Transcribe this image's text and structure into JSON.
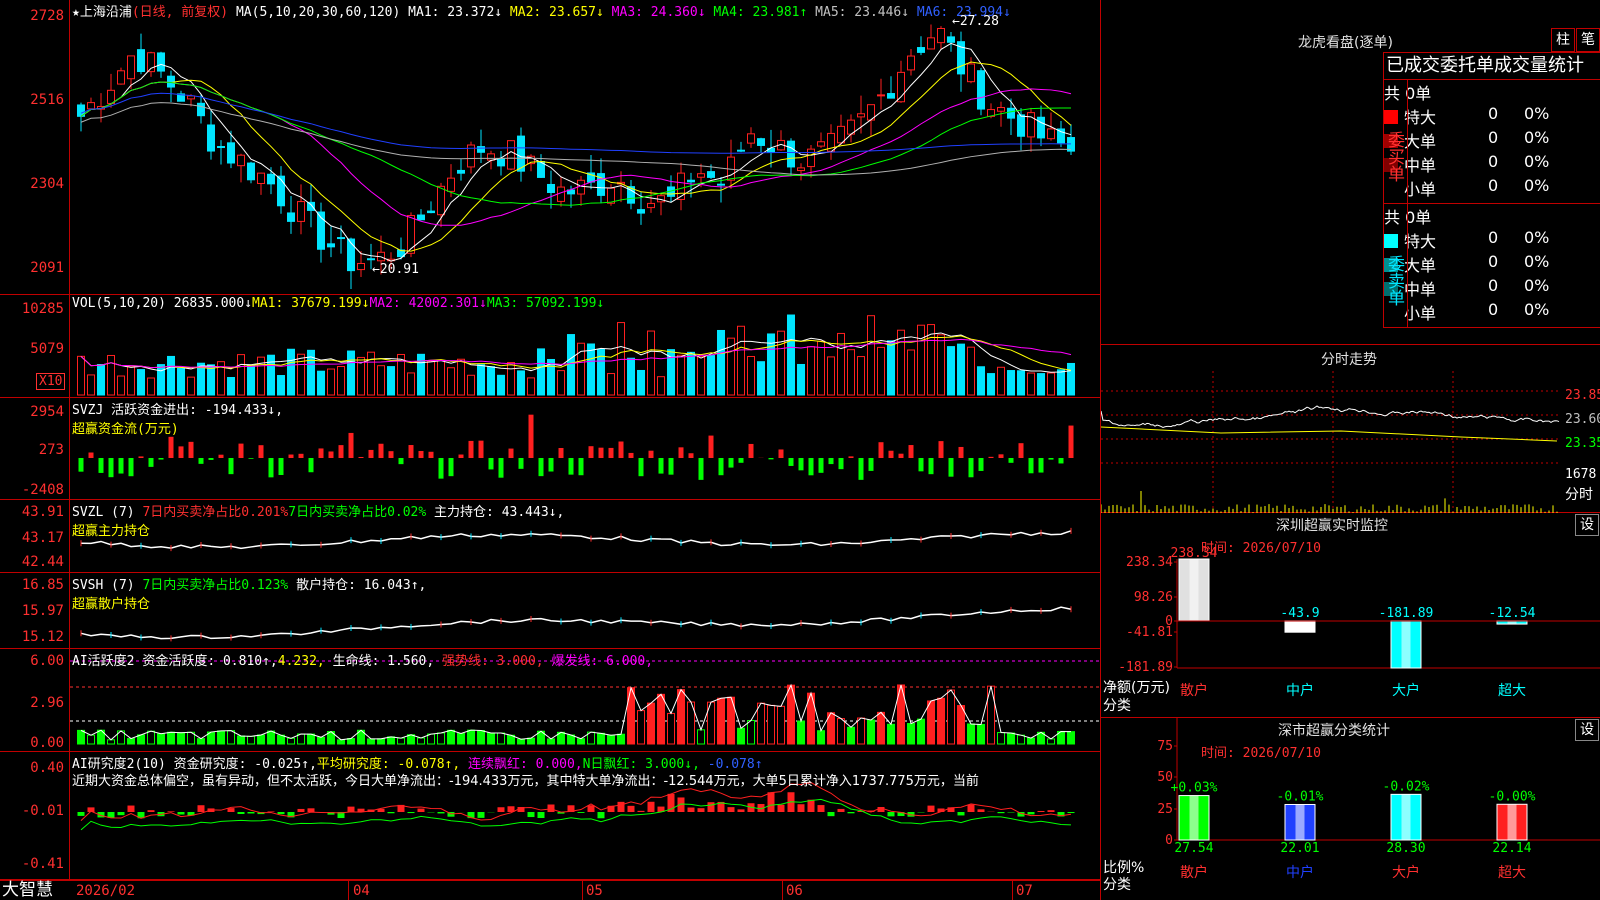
{
  "main": {
    "stock_name": "★上海沿浦",
    "period": "(日线, 前复权)",
    "ma_params": "MA(5,10,20,30,60,120)",
    "ma": [
      {
        "label": "MA1:",
        "value": "23.372↓",
        "color": "#ffffff"
      },
      {
        "label": "MA2:",
        "value": "23.657↓",
        "color": "#ffff00"
      },
      {
        "label": "MA3:",
        "value": "24.360↓",
        "color": "#ff00ff"
      },
      {
        "label": "MA4:",
        "value": "23.981↑",
        "color": "#00ff00"
      },
      {
        "label": "MA5:",
        "value": "23.446↓",
        "color": "#c0c0c0"
      },
      {
        "label": "MA6:",
        "value": "23.994↓",
        "color": "#3060ff"
      }
    ],
    "y_labels": [
      "2728",
      "2516",
      "2304",
      "2091"
    ],
    "high_label": "27.28",
    "low_label": "20.91",
    "colors": {
      "up": "#ff2020",
      "down": "#00e5ff",
      "ma1": "#ffffff",
      "ma2": "#ffff00",
      "ma3": "#ff00ff",
      "ma4": "#00ff00",
      "ma5": "#b0b0b0",
      "ma6": "#2040ff"
    }
  },
  "vol": {
    "params": "VOL(5,10,20)",
    "value": "26835.000↓",
    "ma1": "MA1: 37679.199↓",
    "ma2": "MA2: 42002.301↓",
    "ma3": "MA3: 57092.199↓",
    "y_labels": [
      "10285",
      "5079"
    ],
    "unit": "X10"
  },
  "svzj": {
    "name": "SVZJ",
    "label": "活跃资金进出: -194.433↓,",
    "subtitle": "超赢资金流(万元)",
    "y_labels": [
      "2954",
      "273",
      "-2408"
    ]
  },
  "svzl": {
    "name": "SVZL (7)",
    "l1": "7日内买卖净占比0.201%",
    "l2": "7日内买卖净占比0.02%",
    "l3": "主力持仓: 43.443↓,",
    "subtitle": "超赢主力持仓",
    "y_labels": [
      "43.91",
      "43.17",
      "42.44"
    ]
  },
  "svsh": {
    "name": "SVSH (7)",
    "l1": "7日内买卖净占比0.123%",
    "l2": "散户持仓: 16.043↑,",
    "subtitle": "超赢散户持仓",
    "y_labels": [
      "16.85",
      "15.97",
      "15.12"
    ]
  },
  "ai1": {
    "name": "AI活跃度2",
    "l1": "资金活跃度: 0.810↑,",
    "l2": "4.232,",
    "l3": "生命线: 1.560,",
    "l4": "强势线: 3.000,",
    "l5": "爆发线: 6.000,",
    "y_labels": [
      "6.00",
      "2.96",
      "0.00"
    ]
  },
  "ai2": {
    "name": "AI研究度2(10)",
    "l1": "资金研究度: -0.025↑,",
    "l2": "平均研究度: -0.078↑,",
    "l3": "连续飘红: 0.000,",
    "l4": "N日飘红: 3.000↓,",
    "l5": "-0.078↑",
    "note": "近期大资金总体偏空，虽有异动，但不太活跃，今日大单净流出：-194.433万元，其中特大单净流出：-12.544万元，大单5日累计净入1737.775万元，当前",
    "y_labels": [
      "0.40",
      "-0.01",
      "-0.41"
    ]
  },
  "xaxis": {
    "brand": "大智慧",
    "labels": [
      "2026/02",
      "04",
      "05",
      "06",
      "07"
    ]
  },
  "lhb": {
    "title": "龙虎看盘(逐单)",
    "btn1": "柱",
    "btn2": "笔",
    "subtitle": "已成交委托单成交量统计",
    "buy": {
      "side": "委买单",
      "total": "共 0单",
      "rows": [
        {
          "name": "特大",
          "v": "0",
          "p": "0%",
          "c": "#ff0000"
        },
        {
          "name": "大单",
          "v": "0",
          "p": "0%",
          "c": "#a00000"
        },
        {
          "name": "中单",
          "v": "0",
          "p": "0%",
          "c": "#800000"
        },
        {
          "name": "小单",
          "v": "0",
          "p": "0%",
          "c": "#000000"
        }
      ]
    },
    "sell": {
      "side": "委卖单",
      "total": "共 0单",
      "rows": [
        {
          "name": "特大",
          "v": "0",
          "p": "0%",
          "c": "#00ffff"
        },
        {
          "name": "大单",
          "v": "0",
          "p": "0%",
          "c": "#009090"
        },
        {
          "name": "中单",
          "v": "0",
          "p": "0%",
          "c": "#007070"
        },
        {
          "name": "小单",
          "v": "0",
          "p": "0%",
          "c": "#000000"
        }
      ]
    }
  },
  "fenshi": {
    "title": "分时走势",
    "y_labels": [
      "23.85",
      "23.60",
      "23.35"
    ],
    "vol_label": "1678",
    "unit": "分时"
  },
  "monitor": {
    "title": "深圳超赢实时监控",
    "btn": "设",
    "time": "时间: 2026/07/10",
    "y_labels": [
      "238.34",
      "98.26",
      "0",
      "-41.81",
      "-181.89"
    ],
    "axis_title": "净额(万元)",
    "axis_sub": "分类",
    "bars": [
      {
        "name": "散户",
        "value": 238.34,
        "label": "238.34",
        "color": "#e0e0e0",
        "name_color": "#ff3030"
      },
      {
        "name": "中户",
        "value": -43.9,
        "label": "-43.9",
        "color": "#ffffff",
        "name_color": "#00ffff"
      },
      {
        "name": "大户",
        "value": -181.89,
        "label": "-181.89",
        "color": "#00ffff",
        "name_color": "#00ffff"
      },
      {
        "name": "超大",
        "value": -12.54,
        "label": "-12.54",
        "color": "#00ffff",
        "name_color": "#00ffff"
      }
    ]
  },
  "cls": {
    "title": "深市超赢分类统计",
    "btn": "设",
    "time": "时间: 2026/07/10",
    "y_labels": [
      "75",
      "50",
      "25",
      "0"
    ],
    "axis_title": "比例%",
    "axis_sub": "分类",
    "bars": [
      {
        "name": "散户",
        "value": 27.54,
        "label": "27.54",
        "top": "+0.03%",
        "color": "#00ff00",
        "name_color": "#ff3030"
      },
      {
        "name": "中户",
        "value": 22.01,
        "label": "22.01",
        "top": "-0.01%",
        "color": "#2040ff",
        "name_color": "#2040ff"
      },
      {
        "name": "大户",
        "value": 28.3,
        "label": "28.30",
        "top": "-0.02%",
        "color": "#00ffff",
        "name_color": "#ff3030"
      },
      {
        "name": "超大",
        "value": 22.14,
        "label": "22.14",
        "top": "-0.00%",
        "color": "#ff2020",
        "name_color": "#ff3030"
      }
    ]
  }
}
